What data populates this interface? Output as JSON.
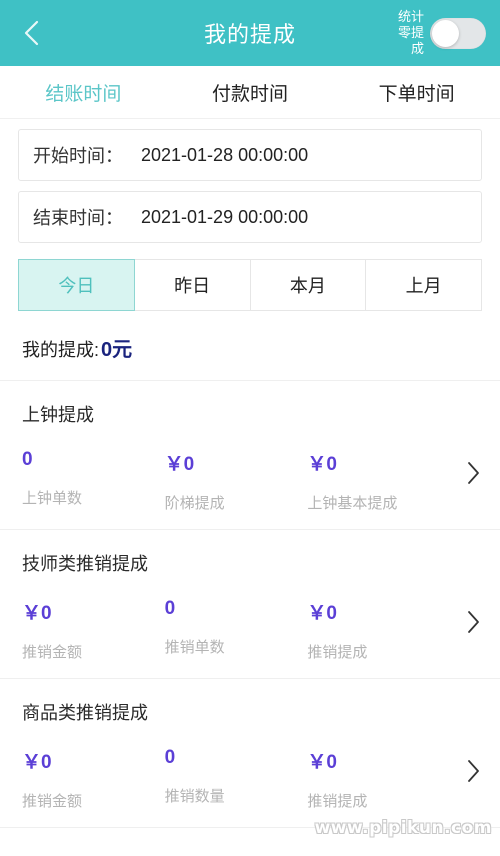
{
  "header": {
    "back_icon": "chevron-left-icon",
    "title": "我的提成",
    "toggle_label_line1": "统计",
    "toggle_label_line2": "零提成",
    "toggle_state": "off",
    "background_color": "#3fc1c5"
  },
  "tabs": [
    {
      "label": "结账时间",
      "active": true
    },
    {
      "label": "付款时间",
      "active": false
    },
    {
      "label": "下单时间",
      "active": false
    }
  ],
  "date_fields": [
    {
      "label": "开始时间：",
      "value": "2021-01-28 00:00:00"
    },
    {
      "label": "结束时间：",
      "value": "2021-01-29 00:00:00"
    }
  ],
  "quick_ranges": [
    {
      "label": "今日",
      "active": true
    },
    {
      "label": "昨日",
      "active": false
    },
    {
      "label": "本月",
      "active": false
    },
    {
      "label": "上月",
      "active": false
    }
  ],
  "summary": {
    "label": "我的提成:",
    "value": "0元",
    "value_color": "#1a237e"
  },
  "sections": [
    {
      "title": "上钟提成",
      "chevron_icon": "chevron-right-icon",
      "stats": [
        {
          "value": "0",
          "label": "上钟单数"
        },
        {
          "value": "￥0",
          "label": "阶梯提成"
        },
        {
          "value": "￥0",
          "label": "上钟基本提成"
        }
      ]
    },
    {
      "title": "技师类推销提成",
      "chevron_icon": "chevron-right-icon",
      "stats": [
        {
          "value": "￥0",
          "label": "推销金额"
        },
        {
          "value": "0",
          "label": "推销单数"
        },
        {
          "value": "￥0",
          "label": "推销提成"
        }
      ]
    },
    {
      "title": "商品类推销提成",
      "chevron_icon": "chevron-right-icon",
      "stats": [
        {
          "value": "￥0",
          "label": "推销金额"
        },
        {
          "value": "0",
          "label": "推销数量"
        },
        {
          "value": "￥0",
          "label": "推销提成"
        }
      ]
    }
  ],
  "watermark": "www.pipikun.com",
  "accent_color": "#5bc6c8",
  "stat_value_color": "#5b3fd6"
}
